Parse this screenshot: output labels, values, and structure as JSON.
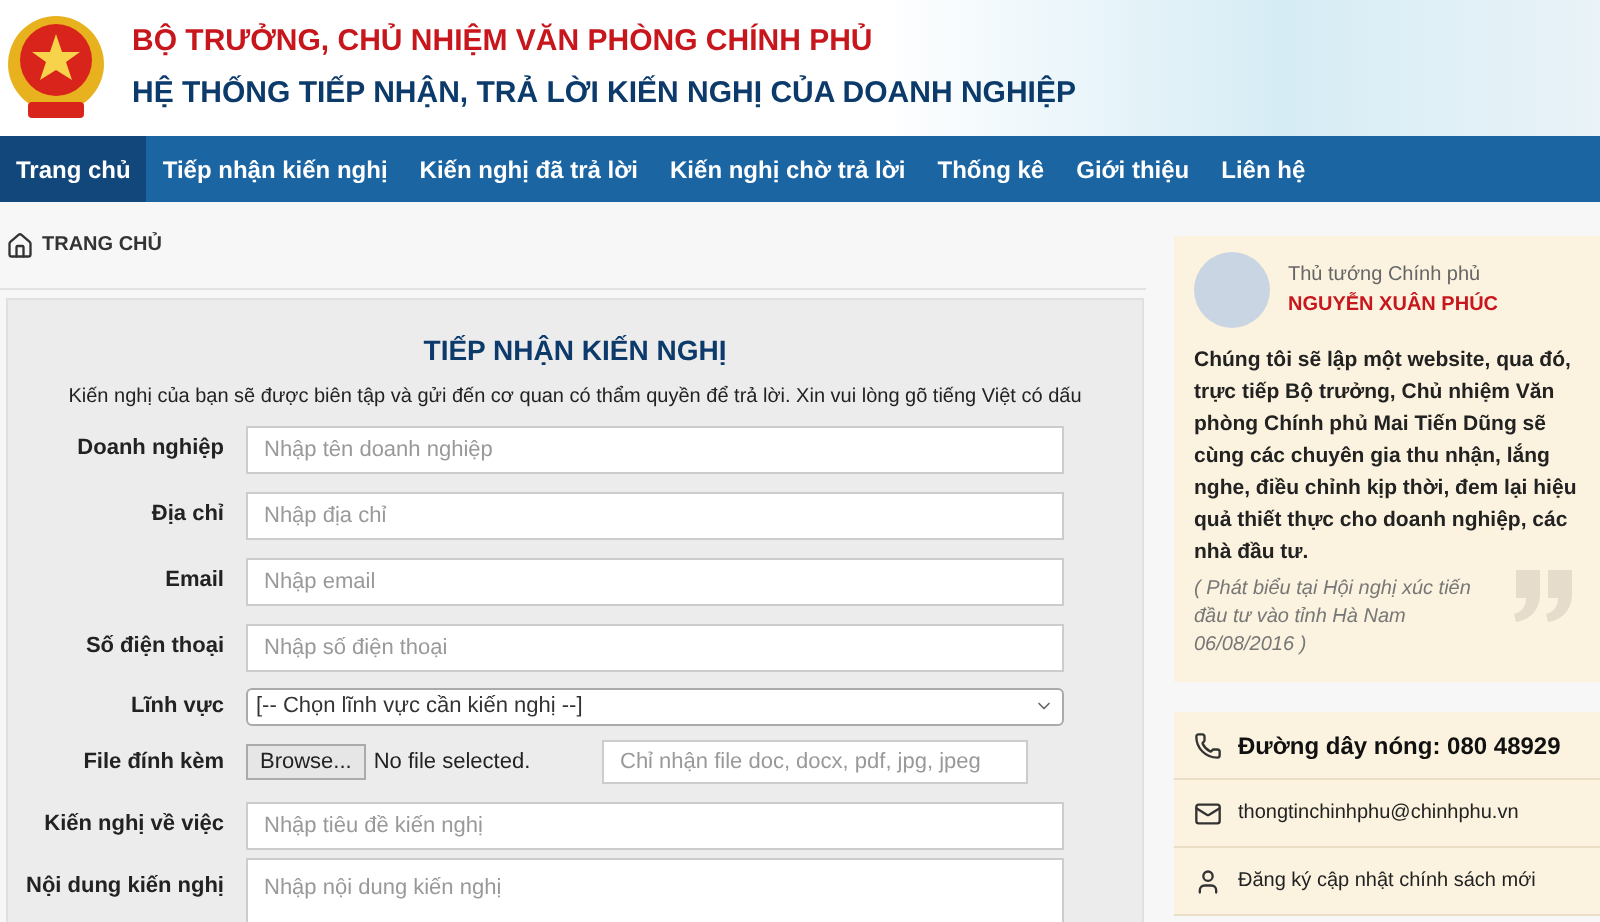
{
  "header": {
    "line_1": "BỘ TRƯỞNG, CHỦ NHIỆM VĂN PHÒNG CHÍNH PHỦ",
    "line_2": "HỆ THỐNG TIẾP NHẬN, TRẢ LỜI KIẾN NGHỊ CỦA DOANH NGHIỆP"
  },
  "nav": [
    {
      "label": "Trang chủ",
      "selected": true
    },
    {
      "label": "Tiếp nhận kiến nghị",
      "selected": false
    },
    {
      "label": "Kiến nghị đã trả lời",
      "selected": false
    },
    {
      "label": "Kiến nghị chờ trả lời",
      "selected": false
    },
    {
      "label": "Thống kê",
      "selected": false
    },
    {
      "label": "Giới thiệu",
      "selected": false
    },
    {
      "label": "Liên hệ",
      "selected": false
    }
  ],
  "breadcrumb": "TRANG CHỦ",
  "form": {
    "title": "TIẾP NHẬN KIẾN NGHỊ",
    "note": "Kiến nghị của bạn sẽ được biên tập và gửi đến cơ quan có thẩm quyền để trả lời. Xin vui lòng gõ tiếng Việt có dấu",
    "fields": [
      {
        "kind": "text",
        "label": "Doanh nghiệp",
        "placeholder": "Nhập tên doanh nghiệp"
      },
      {
        "kind": "text",
        "label": "Địa chỉ",
        "placeholder": "Nhập địa chỉ"
      },
      {
        "kind": "text",
        "label": "Email",
        "placeholder": "Nhập email"
      },
      {
        "kind": "text",
        "label": "Số điện thoại",
        "placeholder": "Nhập số điện thoại"
      },
      {
        "kind": "select",
        "label": "Lĩnh vực",
        "value": "[-- Chọn lĩnh vực cần kiến nghị --]"
      },
      {
        "kind": "file",
        "label": "File đính kèm",
        "button": "Browse...",
        "status": "No file selected.",
        "placeholder": "Chỉ nhận file doc, docx, pdf, jpg, jpeg"
      },
      {
        "kind": "text",
        "label": "Kiến nghị về việc",
        "placeholder": "Nhập tiêu đề kiến nghị"
      },
      {
        "kind": "textarea",
        "label": "Nội dung kiến nghị",
        "placeholder": "Nhập nội dung kiến nghị"
      }
    ]
  },
  "quote": {
    "role": "Thủ tướng Chính phủ",
    "name": "NGUYỄN XUÂN PHÚC",
    "text": "Chúng tôi sẽ lập một website, qua đó, trực tiếp Bộ trưởng, Chủ nhiệm Văn phòng Chính phủ Mai Tiến Dũng sẽ cùng các chuyên gia thu nhận, lắng nghe, điều chỉnh kịp thời, đem lại hiệu quả thiết thực cho doanh nghiệp, các nhà đầu tư.",
    "source": "( Phát biểu tại Hội nghị xúc tiến đầu tư vào tỉnh Hà Nam 06/08/2016 )"
  },
  "contact": [
    {
      "kind": "phone",
      "text": "Đường dây nóng: 080 48929"
    },
    {
      "kind": "email",
      "text": "thongtinchinhphu@chinhphu.vn"
    },
    {
      "kind": "user",
      "text": "Đăng ký cập nhật chính sách mới"
    }
  ]
}
